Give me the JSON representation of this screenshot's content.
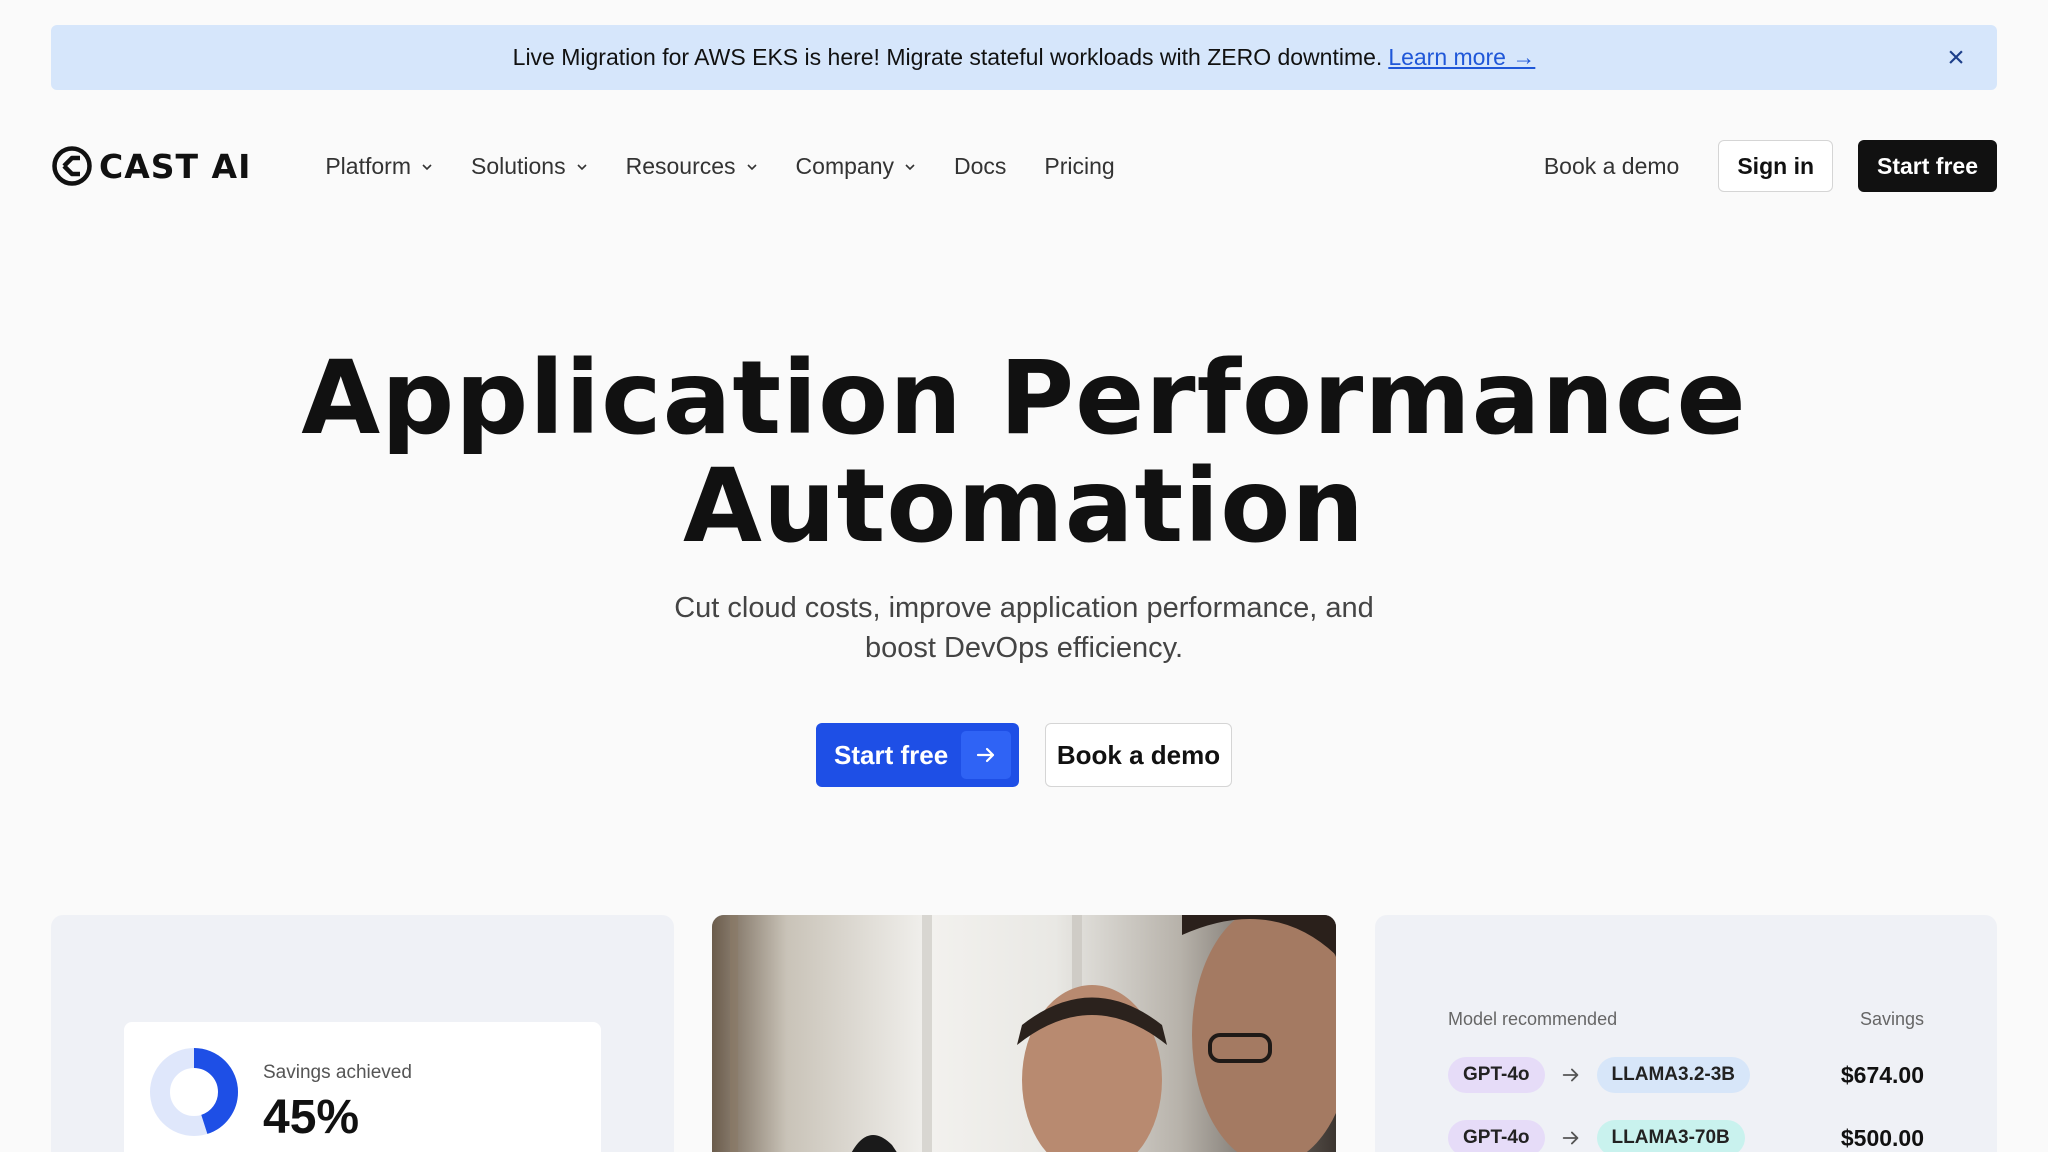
{
  "banner": {
    "message": "Live Migration for AWS EKS is here! Migrate stateful workloads with ZERO downtime.",
    "link_label": "Learn more →",
    "close_icon": "close-icon"
  },
  "header": {
    "logo_text": "CAST AI",
    "nav": [
      {
        "label": "Platform",
        "has_dropdown": true
      },
      {
        "label": "Solutions",
        "has_dropdown": true
      },
      {
        "label": "Resources",
        "has_dropdown": true
      },
      {
        "label": "Company",
        "has_dropdown": true
      },
      {
        "label": "Docs",
        "has_dropdown": false
      },
      {
        "label": "Pricing",
        "has_dropdown": false
      }
    ],
    "book_demo_label": "Book a demo",
    "sign_in_label": "Sign in",
    "start_free_label": "Start free"
  },
  "hero": {
    "title_line1": "Application Performance",
    "title_line2": "Automation",
    "subtitle_line1": "Cut cloud costs, improve application performance, and",
    "subtitle_line2": "boost DevOps efficiency.",
    "primary_cta": "Start free",
    "secondary_cta": "Book a demo"
  },
  "cards": {
    "savings": {
      "label": "Savings achieved",
      "value": "45%",
      "fraction": 0.45
    },
    "models": {
      "header_left": "Model recommended",
      "header_right": "Savings",
      "rows": [
        {
          "from": "GPT-4o",
          "to": "LLAMA3.2-3B",
          "value": "$674.00"
        },
        {
          "from": "GPT-4o",
          "to": "LLAMA3-70B",
          "value": "$500.00"
        }
      ]
    }
  },
  "colors": {
    "banner_bg": "#d6e6fb",
    "primary": "#1e4fe6",
    "dark_button": "#111111",
    "page_bg": "#fafafa"
  }
}
